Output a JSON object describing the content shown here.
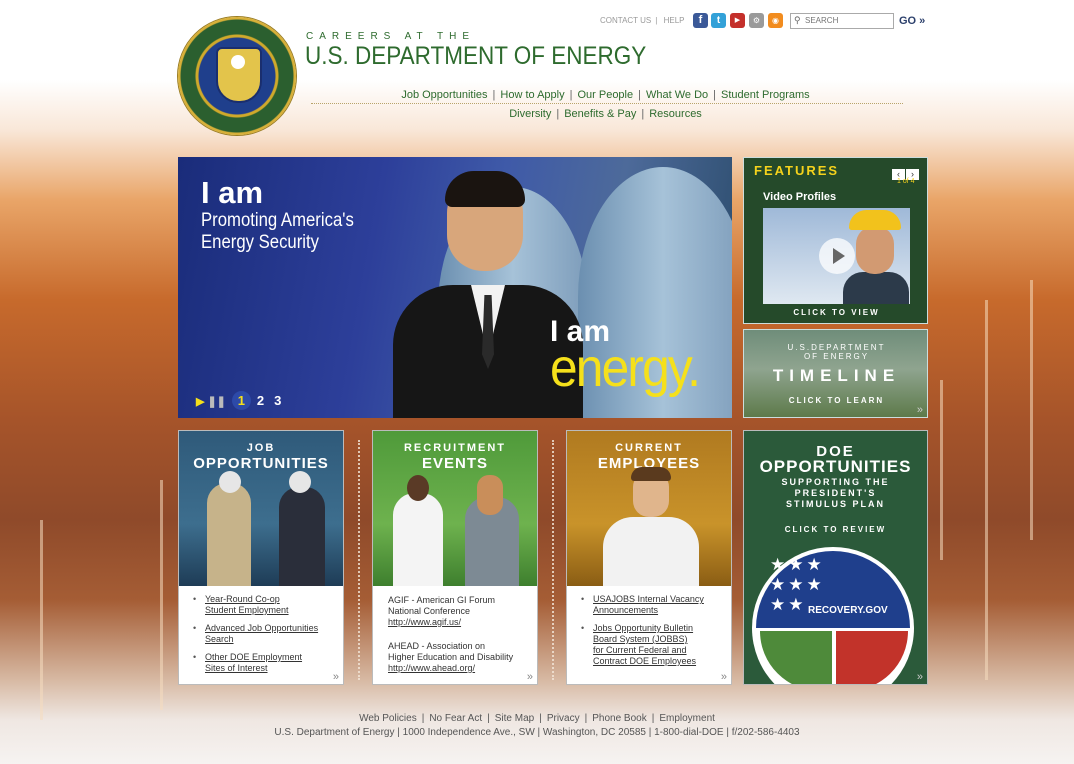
{
  "header": {
    "careers_label": "CAREERS AT THE",
    "title": "U.S. DEPARTMENT OF ENERGY",
    "utility": {
      "contact": "CONTACT US",
      "sep": "|",
      "help": "HELP"
    },
    "social_icons": [
      "facebook-icon",
      "twitter-icon",
      "youtube-icon",
      "widget-icon",
      "rss-icon"
    ],
    "search": {
      "placeholder": "SEARCH",
      "go_label": "GO »"
    }
  },
  "nav": {
    "row1": [
      "Job Opportunities",
      "How to Apply",
      "Our People",
      "What We Do",
      "Student Programs"
    ],
    "row2": [
      "Diversity",
      "Benefits & Pay",
      "Resources"
    ],
    "separator": "|"
  },
  "hero": {
    "iam_left": "I am",
    "subtitle_line1": "Promoting America's",
    "subtitle_line2": "Energy Security",
    "iam_right": "I am",
    "energy": "energy.",
    "pager": {
      "active": "1",
      "pages": [
        "2",
        "3"
      ]
    }
  },
  "features": {
    "title": "FEATURES",
    "prev": "‹",
    "next": "›",
    "counter": "1 of 4",
    "subtitle": "Video Profiles",
    "click": "CLICK TO VIEW"
  },
  "timeline": {
    "top_line1": "U.S.DEPARTMENT",
    "top_line2": "OF ENERGY",
    "title": "TIMELINE",
    "click": "CLICK TO LEARN"
  },
  "tiles": {
    "job": {
      "t1": "JOB",
      "t2": "OPPORTUNITIES",
      "links": [
        [
          "Year-Round Co-op",
          "Student Employment"
        ],
        [
          "Advanced Job Opportunities",
          "Search"
        ],
        [
          "Other DOE Employment",
          "Sites of Interest"
        ]
      ]
    },
    "recruit": {
      "t1": "RECRUITMENT",
      "t2": "EVENTS",
      "e1_l1": "AGIF - American GI Forum",
      "e1_l2": "National Conference",
      "e1_link": "http://www.agif.us/",
      "e2_l1": "AHEAD - Association on",
      "e2_l2": "Higher Education and Disability",
      "e2_link": "http://www.ahead.org/"
    },
    "current": {
      "t1": "CURRENT",
      "t2": "EMPLOYEES",
      "links": [
        [
          "USAJOBS Internal Vacancy",
          "Announcements"
        ],
        [
          "Jobs Opportunity Bulletin",
          "Board System (JOBBS)",
          "for Current Federal and",
          "Contract DOE Employees"
        ]
      ]
    },
    "doe": {
      "h1": "DOE",
      "h2": "OPPORTUNITIES",
      "h3_l1": "SUPPORTING THE",
      "h3_l2": "PRESIDENT'S",
      "h3_l3": "STIMULUS PLAN",
      "click": "CLICK TO REVIEW",
      "recovery": "RECOVERY.GOV"
    },
    "more_glyph": "»"
  },
  "footer": {
    "links": [
      "Web Policies",
      "No Fear Act",
      "Site Map",
      "Privacy",
      "Phone Book",
      "Employment"
    ],
    "address": "U.S. Department of Energy | 1000 Independence Ave., SW | Washington, DC 20585 | 1-800-dial-DOE | f/202-586-4403"
  },
  "colors": {
    "brand_green": "#2e6b2e",
    "feature_yellow": "#f5d21c",
    "energy_yellow": "#f5e01b",
    "hero_blue": "#2d3f9a"
  }
}
